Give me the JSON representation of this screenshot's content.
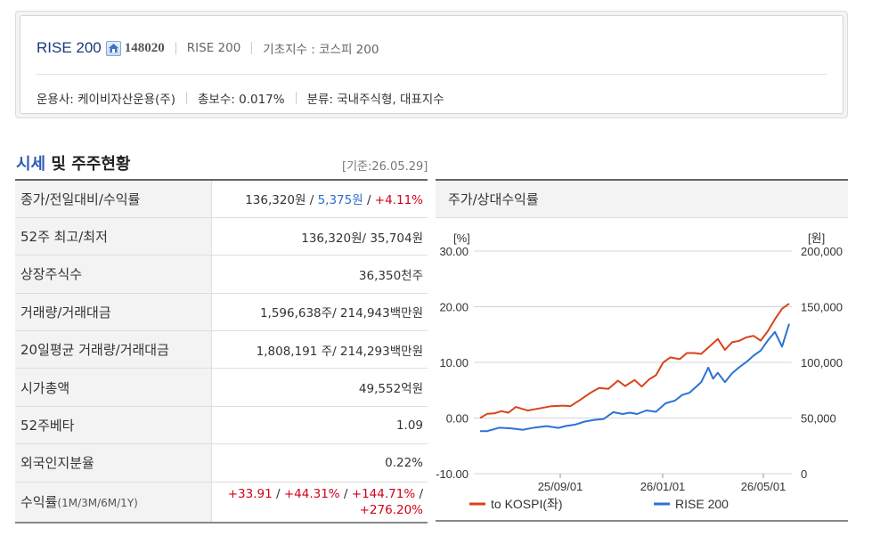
{
  "header": {
    "fund_name": "RISE 200",
    "fund_code": "148020",
    "meta1": "RISE 200",
    "meta2": "기초지수 : 코스피 200",
    "manager": "운용사: 케이비자산운용(주)",
    "fee": "총보수: 0.017%",
    "category": "분류: 국내주식형, 대표지수"
  },
  "section": {
    "title_blue": "시세",
    "title_rest": " 및 주주현황",
    "base_date": "[기준:26.05.29]"
  },
  "table": {
    "r1_label": "종가/전일대비/수익률",
    "r1_price": "136,320원",
    "r1_slash1": " / ",
    "r1_change": "5,375원",
    "r1_slash2": " / ",
    "r1_rate": "+4.11%",
    "r2_label": "52주 최고/최저",
    "r2_value": "136,320원/ 35,704원",
    "r3_label": "상장주식수",
    "r3_value": "36,350천주",
    "r4_label": "거래량/거래대금",
    "r4_value": "1,596,638주/ 214,943백만원",
    "r5_label": "20일평균 거래량/거래대금",
    "r5_value": "1,808,191 주/ 214,293백만원",
    "r6_label": "시가총액",
    "r6_value": "49,552억원",
    "r7_label": "52주베타",
    "r7_value": "1.09",
    "r8_label": "외국인지분율",
    "r8_value": "0.22%",
    "r9_label": "수익률",
    "r9_label_small": "(1M/3M/6M/1Y)",
    "r9_v1": "+33.91",
    "r9_s1": " / ",
    "r9_v2": "+44.31%",
    "r9_s2": " / ",
    "r9_v3": "+144.71%",
    "r9_s3": " /",
    "r9_v4": "+276.20%"
  },
  "chart_data": {
    "type": "line",
    "title": "주가/상대수익률",
    "left_unit": "[%]",
    "right_unit": "[원]",
    "left_ticks": [
      "30.00",
      "20.00",
      "10.00",
      "0.00",
      "-10.00"
    ],
    "right_ticks": [
      "200,000",
      "150,000",
      "100,000",
      "50,000",
      "0"
    ],
    "x_ticks": [
      "25/09/01",
      "26/01/01",
      "26/05/01"
    ],
    "left_range": [
      -10,
      30
    ],
    "right_range": [
      0,
      200000
    ],
    "grid": true,
    "legend_position": "bottom-left",
    "series": [
      {
        "name": "to KOSPI(좌)",
        "axis": "left",
        "color": "#d9431a",
        "points": [
          [
            0,
            0
          ],
          [
            0.03,
            0.6
          ],
          [
            0.06,
            1.1
          ],
          [
            0.09,
            0.9
          ],
          [
            0.12,
            1.3
          ],
          [
            0.15,
            1.7
          ],
          [
            0.2,
            1.6
          ],
          [
            0.25,
            1.9
          ],
          [
            0.3,
            1.8
          ],
          [
            0.35,
            2.2
          ],
          [
            0.38,
            2.0
          ],
          [
            0.42,
            3.2
          ],
          [
            0.46,
            4.6
          ],
          [
            0.5,
            5.1
          ],
          [
            0.54,
            5.6
          ],
          [
            0.58,
            6.4
          ],
          [
            0.61,
            6.1
          ],
          [
            0.65,
            6.5
          ],
          [
            0.68,
            6.0
          ],
          [
            0.71,
            6.6
          ],
          [
            0.74,
            7.9
          ],
          [
            0.77,
            9.9
          ],
          [
            0.8,
            10.8
          ],
          [
            0.84,
            10.5
          ],
          [
            0.87,
            11.6
          ],
          [
            0.9,
            11.9
          ],
          [
            0.93,
            11.2
          ],
          [
            0.96,
            13.0
          ],
          [
            1.0,
            13.9
          ],
          [
            1.03,
            12.6
          ],
          [
            1.06,
            13.3
          ],
          [
            1.09,
            14.1
          ],
          [
            1.12,
            14.4
          ],
          [
            1.15,
            14.7
          ],
          [
            1.18,
            14.1
          ],
          [
            1.21,
            15.3
          ],
          [
            1.24,
            18.1
          ],
          [
            1.27,
            19.3
          ],
          [
            1.3,
            20.8
          ]
        ]
      },
      {
        "name": "RISE 200",
        "axis": "right",
        "color": "#2a73d6",
        "points": [
          [
            0,
            37000
          ],
          [
            0.03,
            39000
          ],
          [
            0.08,
            40000
          ],
          [
            0.13,
            40500
          ],
          [
            0.18,
            40800
          ],
          [
            0.23,
            41000
          ],
          [
            0.28,
            41500
          ],
          [
            0.33,
            42000
          ],
          [
            0.36,
            41500
          ],
          [
            0.4,
            45000
          ],
          [
            0.44,
            46500
          ],
          [
            0.48,
            48000
          ],
          [
            0.52,
            50000
          ],
          [
            0.56,
            54000
          ],
          [
            0.6,
            55000
          ],
          [
            0.63,
            53500
          ],
          [
            0.66,
            54500
          ],
          [
            0.7,
            55500
          ],
          [
            0.74,
            57000
          ],
          [
            0.78,
            62000
          ],
          [
            0.82,
            66500
          ],
          [
            0.85,
            69500
          ],
          [
            0.88,
            74000
          ],
          [
            0.91,
            77000
          ],
          [
            0.93,
            82000
          ],
          [
            0.96,
            96000
          ],
          [
            0.98,
            84000
          ],
          [
            1.0,
            90500
          ],
          [
            1.03,
            83000
          ],
          [
            1.06,
            89000
          ],
          [
            1.09,
            97000
          ],
          [
            1.12,
            99000
          ],
          [
            1.15,
            107000
          ],
          [
            1.18,
            110000
          ],
          [
            1.21,
            119500
          ],
          [
            1.24,
            128000
          ],
          [
            1.27,
            113000
          ],
          [
            1.3,
            136000
          ]
        ]
      }
    ]
  }
}
